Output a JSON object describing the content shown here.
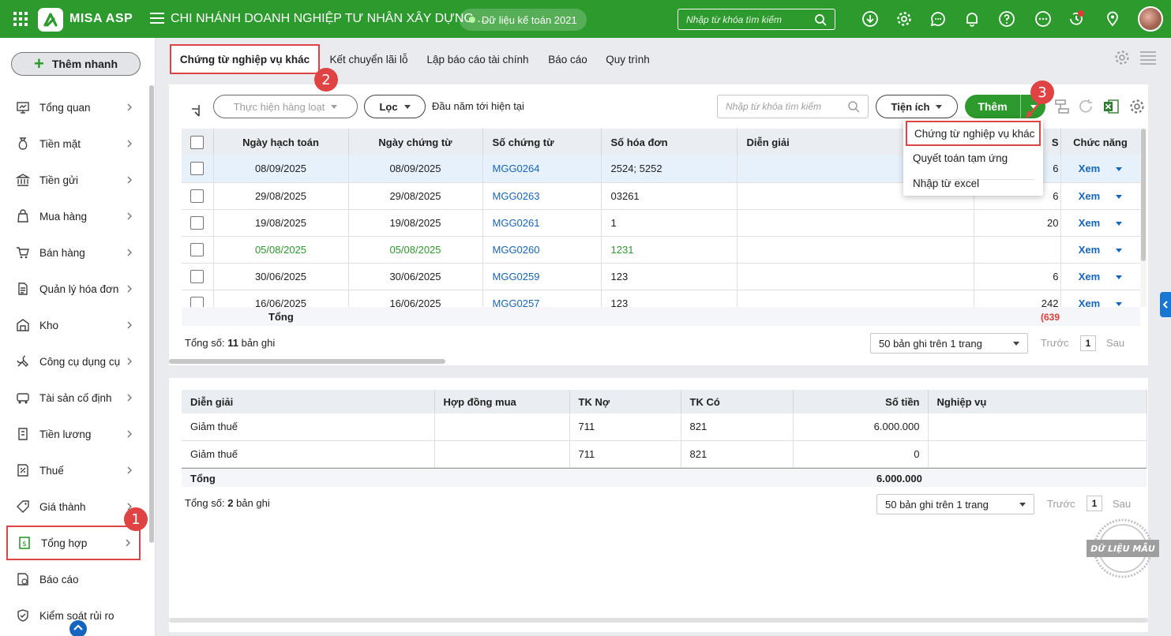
{
  "topbar": {
    "logo_text": "MISA ASP",
    "branch": "CHI NHÁNH DOANH NGHIỆP TƯ NHÂN XÂY DỰNG ...",
    "data_year": "Dữ liệu kế toán 2021",
    "search_placeholder": "Nhập từ khóa tìm kiếm"
  },
  "sidebar": {
    "quick_add": "Thêm nhanh",
    "items": [
      {
        "label": "Tổng quan"
      },
      {
        "label": "Tiền mặt"
      },
      {
        "label": "Tiền gửi"
      },
      {
        "label": "Mua hàng"
      },
      {
        "label": "Bán hàng"
      },
      {
        "label": "Quản lý hóa đơn"
      },
      {
        "label": "Kho"
      },
      {
        "label": "Công cụ dụng cụ"
      },
      {
        "label": "Tài sản cố định"
      },
      {
        "label": "Tiền lương"
      },
      {
        "label": "Thuế"
      },
      {
        "label": "Giá thành"
      },
      {
        "label": "Tổng hợp"
      },
      {
        "label": "Báo cáo"
      },
      {
        "label": "Kiểm soát rủi ro"
      }
    ]
  },
  "tabs": [
    {
      "label": "Chứng từ nghiệp vụ khác"
    },
    {
      "label": "Kết chuyển lãi lỗ"
    },
    {
      "label": "Lập báo cáo tài chính"
    },
    {
      "label": "Báo cáo"
    },
    {
      "label": "Quy trình"
    }
  ],
  "toolbar": {
    "batch": "Thực hiện hàng loạt",
    "filter": "Lọc",
    "period": "Đầu năm tới hiện tại",
    "search_placeholder": "Nhập từ khóa tìm kiếm",
    "utility": "Tiện ích",
    "add": "Thêm"
  },
  "menu": {
    "items": [
      "Chứng từ nghiệp vụ khác",
      "Quyết toán tạm ứng",
      "Nhập từ excel"
    ]
  },
  "grid1": {
    "headers": [
      "Ngày hạch toán",
      "Ngày chứng từ",
      "Số chứng từ",
      "Số hóa đơn",
      "Diễn giải",
      "S",
      "Chức năng"
    ],
    "rows": [
      {
        "ngay_ht": "08/09/2025",
        "ngay_ct": "08/09/2025",
        "so_ct": "MGG0264",
        "so_hd": "2524; 5252",
        "dien_giai": "",
        "so_tien": "6",
        "action": "Xem"
      },
      {
        "ngay_ht": "29/08/2025",
        "ngay_ct": "29/08/2025",
        "so_ct": "MGG0263",
        "so_hd": "03261",
        "dien_giai": "",
        "so_tien": "6",
        "action": "Xem"
      },
      {
        "ngay_ht": "19/08/2025",
        "ngay_ct": "19/08/2025",
        "so_ct": "MGG0261",
        "so_hd": "1",
        "dien_giai": "",
        "so_tien": "20",
        "action": "Xem"
      },
      {
        "ngay_ht": "05/08/2025",
        "ngay_ct": "05/08/2025",
        "so_ct": "MGG0260",
        "so_hd": "1231",
        "dien_giai": "",
        "so_tien": "",
        "action": "Xem"
      },
      {
        "ngay_ht": "30/06/2025",
        "ngay_ct": "30/06/2025",
        "so_ct": "MGG0259",
        "so_hd": "123",
        "dien_giai": "",
        "so_tien": "6",
        "action": "Xem"
      },
      {
        "ngay_ht": "16/06/2025",
        "ngay_ct": "16/06/2025",
        "so_ct": "MGG0257",
        "so_hd": "123",
        "dien_giai": "",
        "so_tien": "242",
        "action": "Xem"
      }
    ],
    "total_label": "Tổng",
    "total_amount": "(639",
    "count_prefix": "Tổng số:",
    "count": "11",
    "count_suffix": "bản ghi",
    "page_size": "50 bản ghi trên 1 trang",
    "prev": "Trước",
    "page": "1",
    "next": "Sau"
  },
  "grid2": {
    "headers": [
      "Diễn giải",
      "Hợp đồng mua",
      "TK Nợ",
      "TK Có",
      "Số tiền",
      "Nghiệp vụ"
    ],
    "rows": [
      {
        "dien_giai": "Giảm thuế",
        "hop_dong": "",
        "tk_no": "711",
        "tk_co": "821",
        "so_tien": "6.000.000",
        "nghiep_vu": ""
      },
      {
        "dien_giai": "Giảm thuế",
        "hop_dong": "",
        "tk_no": "711",
        "tk_co": "821",
        "so_tien": "0",
        "nghiep_vu": ""
      }
    ],
    "total_label": "Tổng",
    "total_amount": "6.000.000",
    "count_prefix": "Tổng số:",
    "count": "2",
    "count_suffix": "bản ghi",
    "page_size": "50 bản ghi trên 1 trang",
    "prev": "Trước",
    "page": "1",
    "next": "Sau"
  },
  "badges": [
    "1",
    "2",
    "3"
  ],
  "stamp": "DỮ LIỆU MẪU",
  "colors": {
    "brand": "#2c9a2c",
    "highlight": "#e04343",
    "link": "#1565c0"
  }
}
